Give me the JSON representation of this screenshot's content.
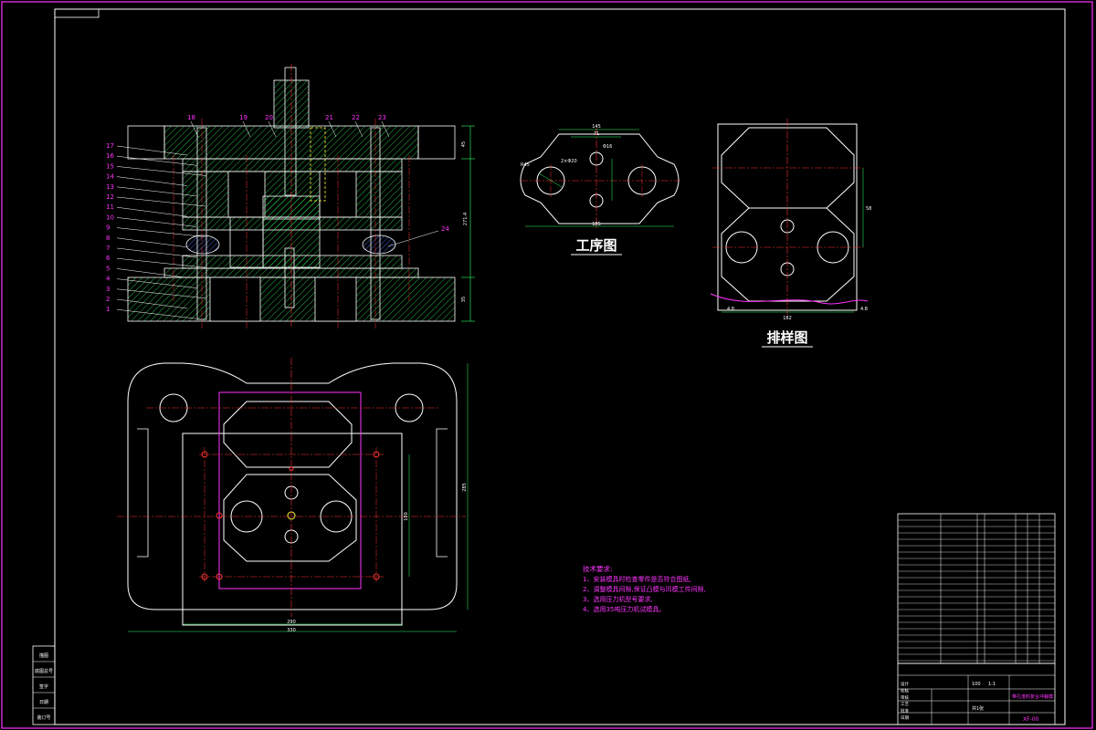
{
  "titles": {
    "process": "工序图",
    "layout": "排样图"
  },
  "tech": {
    "heading": "技术要求:",
    "items": [
      "1、安装模具时检查零件是否符合图纸,",
      "2、调整模具间隙,保证凸模与凹模工件间隙,",
      "3、选用压力机型号要求,",
      "4、选用35吨压力机试模具。"
    ]
  },
  "section_view": {
    "part_numbers_left": [
      "17",
      "16",
      "15",
      "14",
      "13",
      "12",
      "11",
      "10",
      "9",
      "8",
      "7",
      "6",
      "5",
      "4",
      "3",
      "2",
      "1"
    ],
    "part_numbers_top": [
      "18",
      "19",
      "20",
      "21",
      "22",
      "23"
    ],
    "part_number_right": "24",
    "dims": {
      "height_total": "271.4",
      "top_plate": "45",
      "bottom_plate": "35"
    }
  },
  "process_dims": {
    "top_a": "145",
    "top_b": "71",
    "left_r": "R45",
    "hole": "2×Φ20",
    "small": "Φ16",
    "bottom": "185"
  },
  "layout_dims": {
    "pitch": "58",
    "bottom": "182",
    "margin_l": "4.8",
    "margin_r": "4.8"
  },
  "plan_view": {
    "dim_w1": "330",
    "dim_w2": "290",
    "dim_h1": "285",
    "dim_h2": "180"
  },
  "title_block": {
    "drawing_name": "带孔落料复合冲裁模",
    "code": "XF-00",
    "scale": "1:1",
    "material_qty": "100",
    "sheet": "共1张",
    "footer": [
      "设计",
      "校核",
      "审核",
      "工艺",
      "批准",
      "日期"
    ],
    "stamp_lines": [
      "模具设计与",
      "制造专业",
      "冲压模具设计"
    ]
  },
  "border_tabs": [
    "描图",
    "底图总号",
    "签字",
    "日期",
    "装订号"
  ]
}
